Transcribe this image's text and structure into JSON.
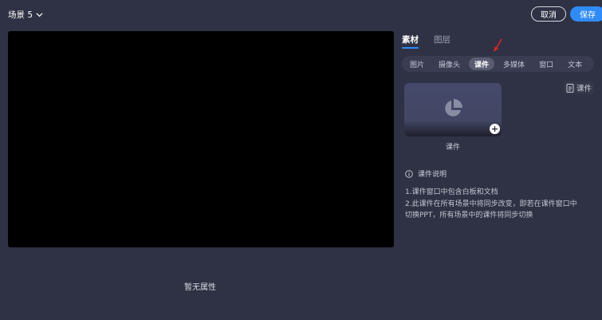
{
  "header": {
    "scene_title": "场景 5",
    "cancel_label": "取消",
    "save_label": "保存",
    "colors": {
      "accent": "#2f8cf7",
      "background": "#2f3244",
      "preview": "#000000"
    }
  },
  "preview": {
    "empty_text": "暂无属性"
  },
  "panel": {
    "main_tabs": [
      {
        "label": "素材",
        "active": true
      },
      {
        "label": "图层",
        "active": false
      }
    ],
    "sub_tabs": [
      {
        "label": "图片",
        "active": false
      },
      {
        "label": "摄像头",
        "active": false
      },
      {
        "label": "课件",
        "active": true
      },
      {
        "label": "多媒体",
        "active": false
      },
      {
        "label": "窗口",
        "active": false
      },
      {
        "label": "文本",
        "active": false
      }
    ],
    "courseware_link": "课件",
    "card": {
      "label": "课件",
      "icon": "pie-chart-icon",
      "add_icon": "plus-icon"
    },
    "description": {
      "title": "课件说明",
      "lines": [
        "1.课件窗口中包含白板和文档",
        "2.此课件在所有场景中将同步改变，即若在课件窗口中",
        "切换PPT，所有场景中的课件将同步切换"
      ]
    }
  }
}
